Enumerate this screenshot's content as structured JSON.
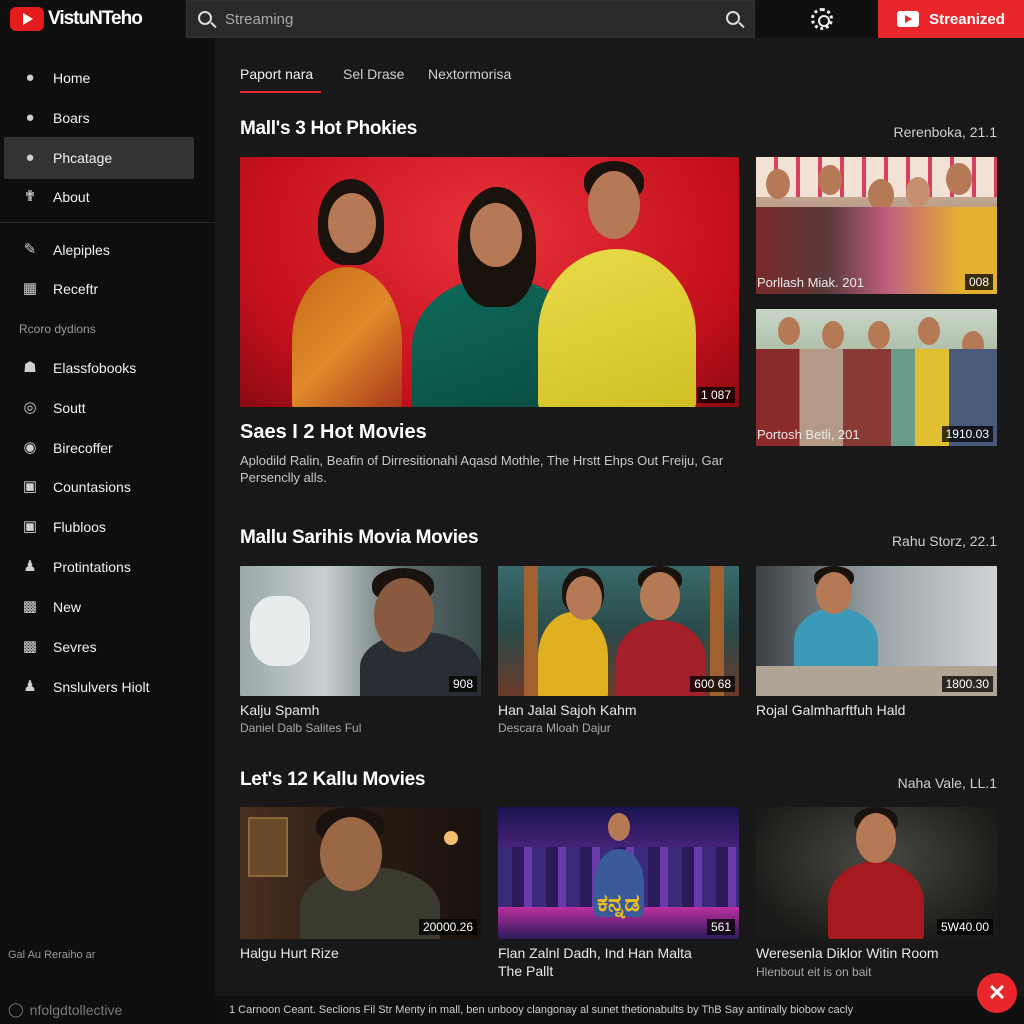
{
  "header": {
    "logo_text": "VistuNTeho",
    "search_placeholder": "Streaming",
    "cta_label": "Streanized"
  },
  "sidebar": {
    "items": [
      {
        "label": "Home",
        "icon": "user-icon"
      },
      {
        "label": "Boars",
        "icon": "user-icon"
      },
      {
        "label": "Phcatage",
        "icon": "user-icon",
        "active": true
      },
      {
        "label": "About",
        "icon": "pin-icon"
      }
    ],
    "items2": [
      {
        "label": "Alepiples",
        "icon": "wrench-icon"
      },
      {
        "label": "Receftr",
        "icon": "calendar-icon"
      }
    ],
    "section_caption": "Rcoro dydions",
    "items3": [
      {
        "label": "Elassfobooks",
        "icon": "house-icon"
      },
      {
        "label": "Soutt",
        "icon": "target-icon"
      },
      {
        "label": "Birecoffer",
        "icon": "shield-icon"
      },
      {
        "label": "Countasions",
        "icon": "card-icon"
      },
      {
        "label": "Flubloos",
        "icon": "card-icon"
      },
      {
        "label": "Protintations",
        "icon": "people-icon"
      },
      {
        "label": "New",
        "icon": "image-icon"
      },
      {
        "label": "Sevres",
        "icon": "image-icon"
      },
      {
        "label": "Snslulvers Hiolt",
        "icon": "people-icon"
      }
    ],
    "footer_small": "Gal Au Reraiho ar",
    "footer_large": "nfolgdtollective"
  },
  "tabs": [
    "Paport nara",
    "Sel Drase",
    "Nextormorisa"
  ],
  "section1": {
    "title": "Mall's 3 Hot Phokies",
    "date": "Rerenboka, 21.1",
    "featured": {
      "duration": "1 087",
      "title": "Saes I 2 Hot Movies",
      "description": "Aplodild Ralin, Beafin of Dirresitionahl Aqasd Mothle, The Hrstt Ehps Out Freiju, Gar Persenclly alls."
    },
    "side": [
      {
        "title": "Porllash Miak. 201",
        "duration": "008"
      },
      {
        "title": "Portosh Betli, 201",
        "duration": "1910.03"
      }
    ]
  },
  "section2": {
    "title": "Mallu Sarihis Movia Movies",
    "date": "Rahu Storz, 22.1",
    "videos": [
      {
        "title": "Kalju Spamh",
        "subtitle": "Daniel Dalb Salites Ful",
        "duration": "908"
      },
      {
        "title": "Han Jalal Sajoh Kahm",
        "subtitle": "Descara Mloah Dajur",
        "duration": "600 68"
      },
      {
        "title": "Rojal Galmharftfuh Hald",
        "subtitle": "",
        "duration": "1800.30"
      }
    ]
  },
  "section3": {
    "title": "Let's 12 Kallu Movies",
    "date": "Naha Vale, LL.1",
    "videos": [
      {
        "title": "Halgu Hurt Rize",
        "subtitle": "",
        "duration": "20000.26"
      },
      {
        "title": "Flan Zalnl Dadh, Ind Han Malta",
        "subtitle": "The Pallt",
        "duration": "561",
        "poster_text": "ಕನ್ನಡ"
      },
      {
        "title": "Weresenla Diklor Witin Room",
        "subtitle": "Hlenbout eit is on bait",
        "duration": "5W40.00"
      }
    ]
  },
  "bottom_bar": "1  Carnoon Ceant. Seclions Fil Str Menty in mall, ben unbooy clangonay  al sunet thetionabults by ThB Say antinally biobow cacly",
  "colors": {
    "accent": "#e8262b",
    "background": "#181818",
    "sidebar": "#0e0e0e"
  }
}
